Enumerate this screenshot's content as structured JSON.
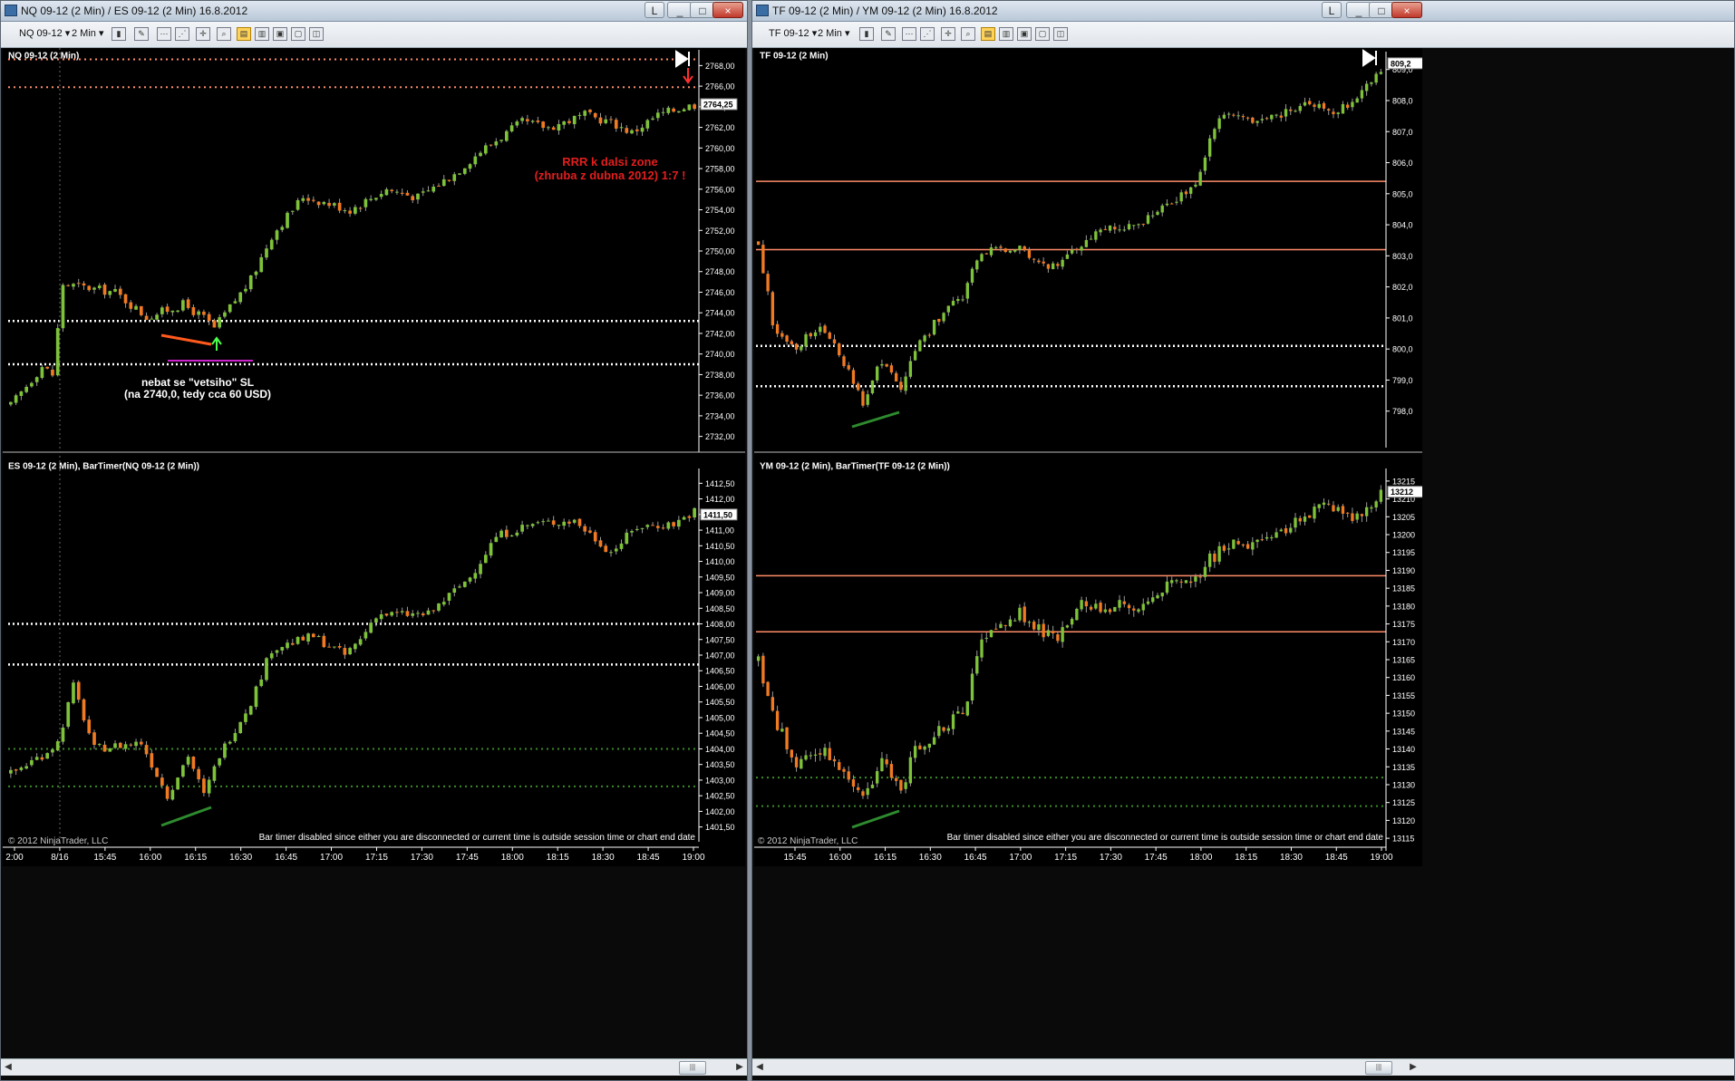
{
  "left_window": {
    "title": "NQ 09-12 (2 Min) / ES 09-12 (2 Min)  16.8.2012",
    "buttons": [
      "L",
      "_",
      "□",
      "×"
    ],
    "toolbar": {
      "instrument": "NQ 09-12",
      "period": "2 Min"
    }
  },
  "right_window": {
    "title": "TF 09-12 (2 Min) / YM 09-12 (2 Min)  16.8.2012",
    "buttons": [
      "L",
      "_",
      "□",
      "×"
    ],
    "toolbar": {
      "instrument": "TF 09-12",
      "period": "2 Min"
    }
  },
  "colors": {
    "up": "#7ec23a",
    "down": "#f07a22",
    "wick": "#9a9a9a",
    "salmon": "#ff8c69",
    "white_dotted": "#ffffff",
    "green_dotted": "#3c8c28",
    "annotation_red": "#e31e1e",
    "magenta": "#cc22cc",
    "copyright": "#c8c8c8"
  },
  "chart_data": [
    {
      "type": "candlestick",
      "title": "NQ 09-12 (2 Min)",
      "ylim": [
        2731,
        2769
      ],
      "yticks": [
        "2768,00",
        "2766,00",
        "2764,00",
        "2762,00",
        "2760,00",
        "2758,00",
        "2756,00",
        "2754,00",
        "2752,00",
        "2750,00",
        "2748,00",
        "2746,00",
        "2744,00",
        "2742,00",
        "2740,00",
        "2738,00",
        "2736,00",
        "2734,00",
        "2732,00"
      ],
      "ytick_values": [
        2768,
        2766,
        2764,
        2762,
        2760,
        2758,
        2756,
        2754,
        2752,
        2750,
        2748,
        2746,
        2744,
        2742,
        2740,
        2738,
        2736,
        2734,
        2732
      ],
      "last_price": "2764,25",
      "last_value": 2764.25,
      "path": [
        [
          0,
          2735.0
        ],
        [
          6,
          2738.8
        ],
        [
          8,
          2738.0
        ],
        [
          10,
          2746.8
        ],
        [
          20,
          2746.0
        ],
        [
          26,
          2743.6
        ],
        [
          33,
          2744.8
        ],
        [
          37,
          2743.5
        ],
        [
          39,
          2742.5
        ],
        [
          40,
          2743.2
        ],
        [
          46,
          2747.2
        ],
        [
          50,
          2751.5
        ],
        [
          56,
          2755.3
        ],
        [
          65,
          2754.0
        ],
        [
          72,
          2756.0
        ],
        [
          78,
          2755.2
        ],
        [
          85,
          2757.5
        ],
        [
          90,
          2759.7
        ],
        [
          98,
          2762.5
        ],
        [
          103,
          2762.0
        ],
        [
          110,
          2763.2
        ],
        [
          115,
          2762.5
        ],
        [
          119,
          2761.5
        ],
        [
          124,
          2763.2
        ],
        [
          129,
          2764.0
        ],
        [
          131,
          2764.2
        ]
      ],
      "volatility": 0.55,
      "hlines": [
        {
          "value": 2768.6,
          "color": "salmon",
          "style": "dotted"
        },
        {
          "value": 2765.9,
          "color": "salmon",
          "style": "dotted"
        },
        {
          "value": 2743.2,
          "color": "white",
          "style": "dotted"
        },
        {
          "value": 2739.0,
          "color": "white",
          "style": "dotted"
        }
      ],
      "annotations": [
        {
          "text": "RRR k dalsi zone",
          "color": "red"
        },
        {
          "text": "(zhruba z dubna 2012) 1:7 !",
          "color": "red"
        },
        {
          "text": "nebat se \"vetsiho\" SL",
          "color": "white"
        },
        {
          "text": "(na 2740,0, tedy cca 60 USD)",
          "color": "white"
        }
      ]
    },
    {
      "type": "candlestick",
      "title": "ES 09-12 (2 Min), BarTimer(NQ 09-12 (2 Min))",
      "ylim": [
        1401.2,
        1412.8
      ],
      "yticks": [
        "1412,50",
        "1412,00",
        "1411,50",
        "1411,00",
        "1410,50",
        "1410,00",
        "1409,50",
        "1409,00",
        "1408,50",
        "1408,00",
        "1407,50",
        "1407,00",
        "1406,50",
        "1406,00",
        "1405,50",
        "1405,00",
        "1404,50",
        "1404,00",
        "1403,50",
        "1403,00",
        "1402,50",
        "1402,00",
        "1401,50"
      ],
      "ytick_values": [
        1412.5,
        1412.0,
        1411.5,
        1411.0,
        1410.5,
        1410.0,
        1409.5,
        1409.0,
        1408.5,
        1408.0,
        1407.5,
        1407.0,
        1406.5,
        1406.0,
        1405.5,
        1405.0,
        1404.5,
        1404.0,
        1403.5,
        1403.0,
        1402.5,
        1402.0,
        1401.5
      ],
      "last_price": "1411,50",
      "last_value": 1411.5,
      "path": [
        [
          0,
          1403.2
        ],
        [
          6,
          1403.8
        ],
        [
          9,
          1404.2
        ],
        [
          12,
          1406.0
        ],
        [
          16,
          1404.0
        ],
        [
          25,
          1404.2
        ],
        [
          30,
          1402.5
        ],
        [
          34,
          1403.8
        ],
        [
          37,
          1402.5
        ],
        [
          40,
          1403.8
        ],
        [
          46,
          1405.5
        ],
        [
          50,
          1407.2
        ],
        [
          58,
          1407.6
        ],
        [
          64,
          1407.0
        ],
        [
          67,
          1407.5
        ],
        [
          70,
          1408.3
        ],
        [
          80,
          1408.3
        ],
        [
          88,
          1409.5
        ],
        [
          93,
          1410.8
        ],
        [
          100,
          1411.2
        ],
        [
          108,
          1411.3
        ],
        [
          115,
          1410.3
        ],
        [
          120,
          1411.1
        ],
        [
          127,
          1411.2
        ],
        [
          131,
          1411.6
        ]
      ],
      "volatility": 0.18,
      "hlines": [
        {
          "value": 1408.0,
          "color": "white",
          "style": "dotted"
        },
        {
          "value": 1406.7,
          "color": "white",
          "style": "dotted"
        },
        {
          "value": 1404.0,
          "color": "green",
          "style": "dotted"
        },
        {
          "value": 1402.8,
          "color": "green",
          "style": "dotted"
        }
      ],
      "xticks": [
        "2:00",
        "8/16",
        "15:45",
        "16:00",
        "16:15",
        "16:30",
        "16:45",
        "17:00",
        "17:15",
        "17:30",
        "17:45",
        "18:00",
        "18:15",
        "18:30",
        "18:45",
        "19:00"
      ],
      "copyright": "© 2012 NinjaTrader, LLC",
      "bar_timer_msg": "Bar timer disabled since either you are disconnected or current time is outside session time or chart end date"
    },
    {
      "type": "candlestick",
      "title": "TF 09-12 (2 Min)",
      "ylim": [
        797.0,
        809.4
      ],
      "yticks": [
        "809,0",
        "808,0",
        "807,0",
        "806,0",
        "805,0",
        "804,0",
        "803,0",
        "802,0",
        "801,0",
        "800,0",
        "799,0",
        "798,0"
      ],
      "ytick_values": [
        809,
        808,
        807,
        806,
        805,
        804,
        803,
        802,
        801,
        800,
        799,
        798
      ],
      "last_price": "809,2",
      "last_value": 809.2,
      "path": [
        [
          0,
          803.5
        ],
        [
          3,
          800.8
        ],
        [
          8,
          800.0
        ],
        [
          13,
          800.8
        ],
        [
          19,
          799.3
        ],
        [
          22,
          798.3
        ],
        [
          26,
          799.6
        ],
        [
          30,
          798.6
        ],
        [
          33,
          800.0
        ],
        [
          38,
          801.0
        ],
        [
          43,
          801.7
        ],
        [
          47,
          803.2
        ],
        [
          55,
          803.2
        ],
        [
          60,
          802.8
        ],
        [
          63,
          802.6
        ],
        [
          67,
          803.2
        ],
        [
          72,
          803.8
        ],
        [
          80,
          804.0
        ],
        [
          87,
          804.7
        ],
        [
          92,
          805.2
        ],
        [
          94,
          806.3
        ],
        [
          98,
          807.7
        ],
        [
          104,
          807.2
        ],
        [
          110,
          807.5
        ],
        [
          116,
          808.0
        ],
        [
          121,
          807.5
        ],
        [
          126,
          808.2
        ],
        [
          131,
          809.0
        ]
      ],
      "volatility": 0.2,
      "hlines": [
        {
          "value": 805.4,
          "color": "salmon",
          "style": "solid"
        },
        {
          "value": 803.2,
          "color": "salmon",
          "style": "solid"
        },
        {
          "value": 800.1,
          "color": "white",
          "style": "dotted"
        },
        {
          "value": 798.8,
          "color": "white",
          "style": "dotted"
        }
      ]
    },
    {
      "type": "candlestick",
      "title": "YM 09-12 (2 Min), BarTimer(TF 09-12 (2 Min))",
      "ylim": [
        13113,
        13217
      ],
      "yticks": [
        "13215",
        "13210",
        "13205",
        "13200",
        "13195",
        "13190",
        "13185",
        "13180",
        "13175",
        "13170",
        "13165",
        "13160",
        "13155",
        "13150",
        "13145",
        "13140",
        "13135",
        "13130",
        "13125",
        "13120",
        "13115"
      ],
      "ytick_values": [
        13215,
        13210,
        13205,
        13200,
        13195,
        13190,
        13185,
        13180,
        13175,
        13170,
        13165,
        13160,
        13155,
        13150,
        13145,
        13140,
        13135,
        13130,
        13125,
        13120,
        13115
      ],
      "last_price": "13212",
      "last_value": 13212,
      "path": [
        [
          0,
          13165
        ],
        [
          3,
          13150
        ],
        [
          8,
          13135
        ],
        [
          13,
          13140
        ],
        [
          19,
          13132
        ],
        [
          22,
          13126
        ],
        [
          26,
          13136
        ],
        [
          30,
          13128
        ],
        [
          33,
          13140
        ],
        [
          38,
          13145
        ],
        [
          43,
          13150
        ],
        [
          47,
          13170
        ],
        [
          55,
          13178
        ],
        [
          60,
          13172
        ],
        [
          63,
          13171
        ],
        [
          67,
          13180
        ],
        [
          72,
          13180
        ],
        [
          80,
          13180
        ],
        [
          87,
          13186
        ],
        [
          92,
          13188
        ],
        [
          95,
          13193
        ],
        [
          100,
          13198
        ],
        [
          106,
          13197
        ],
        [
          112,
          13202
        ],
        [
          118,
          13208
        ],
        [
          124,
          13205
        ],
        [
          128,
          13207
        ],
        [
          131,
          13212
        ]
      ],
      "volatility": 2.2,
      "hlines": [
        {
          "value": 13188.5,
          "color": "salmon",
          "style": "solid"
        },
        {
          "value": 13172.8,
          "color": "salmon",
          "style": "solid"
        },
        {
          "value": 13132.0,
          "color": "green",
          "style": "dotted"
        },
        {
          "value": 13124.0,
          "color": "green",
          "style": "dotted"
        }
      ],
      "xticks": [
        "15:45",
        "16:00",
        "16:15",
        "16:30",
        "16:45",
        "17:00",
        "17:15",
        "17:30",
        "17:45",
        "18:00",
        "18:15",
        "18:30",
        "18:45",
        "19:00"
      ],
      "copyright": "© 2012 NinjaTrader, LLC",
      "bar_timer_msg": "Bar timer disabled since either you are disconnected or current time is outside session time or chart end date"
    }
  ]
}
